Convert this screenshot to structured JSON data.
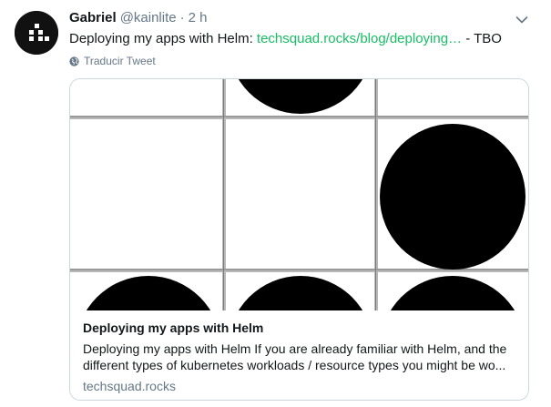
{
  "tweet": {
    "author": {
      "name": "Gabriel",
      "handle": "@kainlite",
      "avatar_icon": "pixel-logo-icon"
    },
    "separator": "·",
    "timestamp": "2 h",
    "menu_icon": "chevron-down-icon",
    "text": {
      "before_link": "Deploying my apps with Helm: ",
      "link": "techsquad.rocks/blog/deploying…",
      "after_link": " - TBO"
    },
    "translate": {
      "icon": "globe-icon",
      "label": "Traducir Tweet"
    },
    "card": {
      "image_icon": "dots-grid-image",
      "title": "Deploying my apps with Helm",
      "description": "Deploying my apps with Helm If you are already familiar with Helm, and the different types of kubernetes workloads / resource types you might be wo...",
      "domain": "techsquad.rocks"
    }
  },
  "colors": {
    "link": "#17bf63",
    "secondary_text": "#657786",
    "primary_text": "#14171a",
    "card_border": "#ccd6dd",
    "avatar_bg": "#111111"
  }
}
